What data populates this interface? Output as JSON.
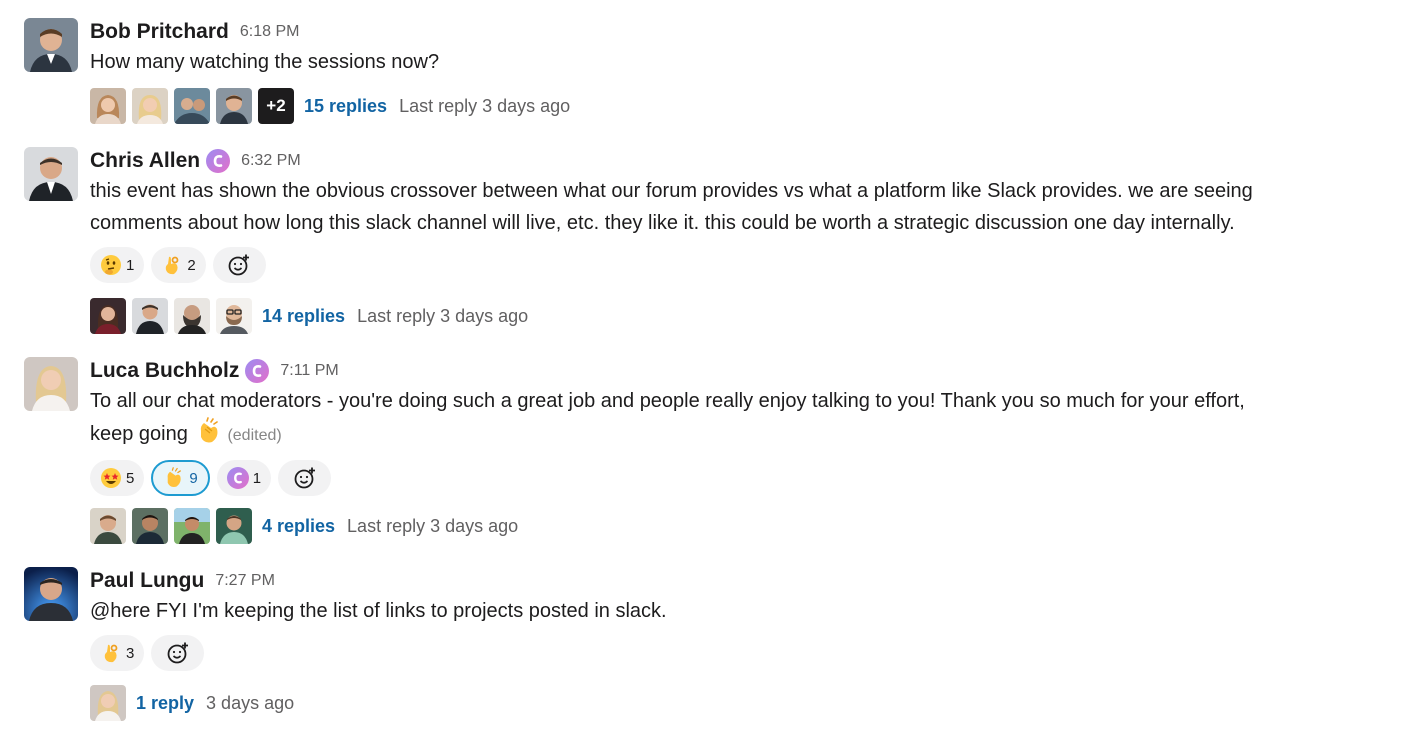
{
  "colors": {
    "link": "#1264a3",
    "muted": "#616061",
    "text": "#1d1c1d",
    "reaction_bg": "#f2f2f3",
    "reaction_active_border": "#1d9bd1"
  },
  "messages": [
    {
      "author": "Bob Pritchard",
      "time": "6:18 PM",
      "text": "How many watching the sessions now?",
      "thread": {
        "extra_participants": "+2",
        "replies": "15 replies",
        "last_reply": "Last reply 3 days ago"
      }
    },
    {
      "author": "Chris Allen",
      "badge": "community-badge-icon",
      "time": "6:32 PM",
      "text_lines": [
        "this event has shown the obvious crossover between what our forum provides vs what a platform like Slack provides.  we are seeing",
        "comments about how long this slack channel will live, etc.  they like it.  this could be worth a strategic discussion one day internally."
      ],
      "reactions": [
        {
          "emoji": "thinking-face-icon",
          "count": "1"
        },
        {
          "emoji": "ok-hand-icon",
          "count": "2"
        }
      ],
      "thread": {
        "replies": "14 replies",
        "last_reply": "Last reply 3 days ago"
      }
    },
    {
      "author": "Luca Buchholz",
      "badge": "community-badge-icon",
      "time": "7:11 PM",
      "text_lines": [
        "To all our chat moderators - you're doing such a great job and people really enjoy talking to you! Thank you so much for your effort,",
        "keep going"
      ],
      "edited": "(edited)",
      "reactions": [
        {
          "emoji": "star-struck-icon",
          "count": "5"
        },
        {
          "emoji": "clapping-hands-icon",
          "count": "9",
          "active": true
        },
        {
          "emoji": "community-badge-icon",
          "count": "1"
        }
      ],
      "thread": {
        "replies": "4 replies",
        "last_reply": "Last reply 3 days ago"
      }
    },
    {
      "author": "Paul Lungu",
      "time": "7:27 PM",
      "text": "@here FYI I'm keeping the list of links to projects posted in slack.",
      "reactions": [
        {
          "emoji": "ok-hand-icon",
          "count": "3"
        }
      ],
      "thread": {
        "replies": "1 reply",
        "last_reply": "3 days ago"
      }
    }
  ]
}
